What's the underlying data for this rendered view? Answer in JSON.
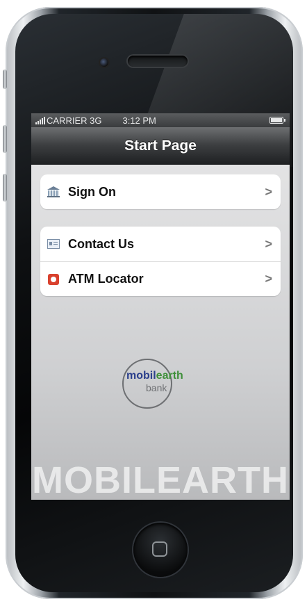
{
  "status_bar": {
    "carrier": "CARRIER 3G",
    "time": "3:12 PM"
  },
  "nav": {
    "title": "Start Page"
  },
  "menu": {
    "group1": [
      {
        "label": "Sign On",
        "icon": "bank-icon"
      }
    ],
    "group2": [
      {
        "label": "Contact Us",
        "icon": "contact-card-icon"
      },
      {
        "label": "ATM Locator",
        "icon": "atm-locator-icon"
      }
    ],
    "chevron": ">"
  },
  "logo": {
    "part1": "mobil",
    "part2": "earth",
    "sub": "bank"
  },
  "watermark": "MOBILEARTH",
  "colors": {
    "brand_blue": "#2b3f8c",
    "brand_green": "#3f8f3a",
    "atm_red": "#d9412e"
  }
}
